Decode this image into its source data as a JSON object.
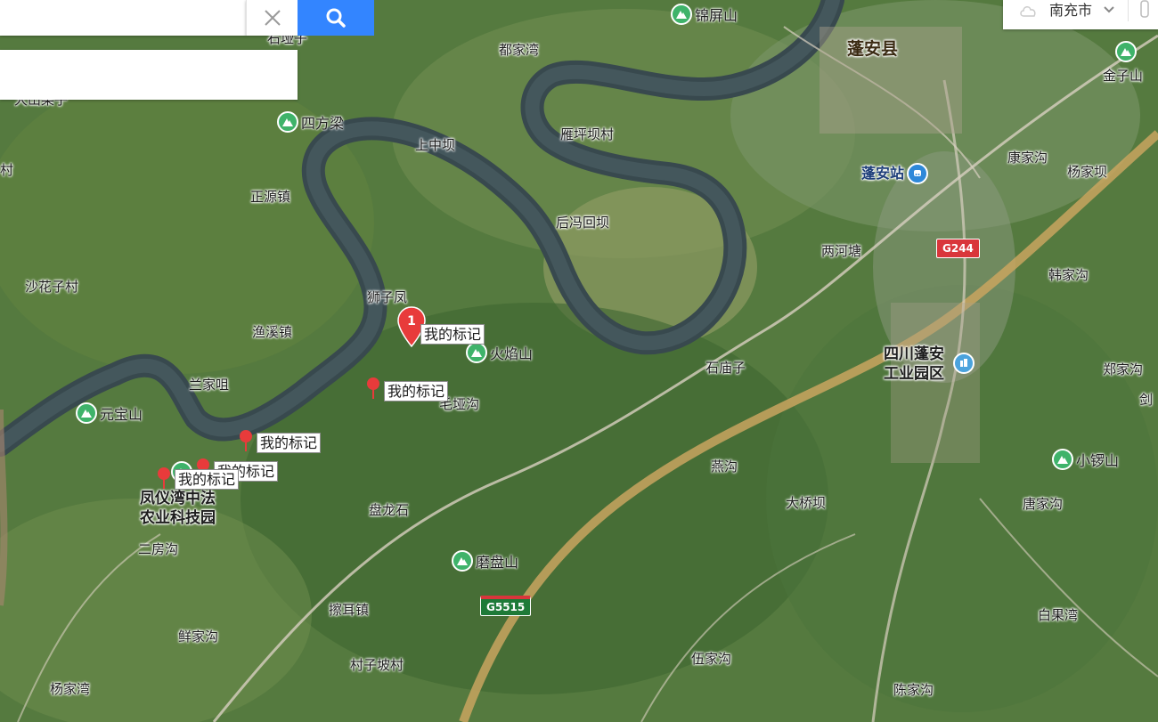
{
  "search": {
    "value": "",
    "placeholder": ""
  },
  "city_selector": {
    "label": "南充市"
  },
  "map": {
    "place_labels": [
      {
        "text": "都家湾"
      },
      {
        "text": "上中坝"
      },
      {
        "text": "雁坪坝村"
      },
      {
        "text": "正源镇"
      },
      {
        "text": "后冯回坝"
      },
      {
        "text": "两河塘"
      },
      {
        "text": "康家沟"
      },
      {
        "text": "杨家坝"
      },
      {
        "text": "沙花子村"
      },
      {
        "text": "渔溪镇"
      },
      {
        "text": "狮子凤"
      },
      {
        "text": "石庙子"
      },
      {
        "text": "韩家沟"
      },
      {
        "text": "兰家咀"
      },
      {
        "text": "毛垭沟"
      },
      {
        "text": "郑家沟"
      },
      {
        "text": "燕沟"
      },
      {
        "text": "大桥坝"
      },
      {
        "text": "唐家沟"
      },
      {
        "text": "二房沟"
      },
      {
        "text": "盘龙石"
      },
      {
        "text": "擦耳镇"
      },
      {
        "text": "白果湾"
      },
      {
        "text": "鲜家沟"
      },
      {
        "text": "村子坡村"
      },
      {
        "text": "伍家沟"
      },
      {
        "text": "杨家湾"
      },
      {
        "text": "陈家沟"
      },
      {
        "text": "石垭子"
      },
      {
        "text": "大山梁子"
      },
      {
        "text": "村"
      },
      {
        "text": "剑"
      }
    ],
    "county_label": "蓬安县",
    "poi_mountains": [
      {
        "text": "锦屏山"
      },
      {
        "text": "金子山"
      },
      {
        "text": "四方梁"
      },
      {
        "text": "火焰山"
      },
      {
        "text": "元宝山"
      },
      {
        "text": "小锣山"
      },
      {
        "text": "磨盘山"
      }
    ],
    "station_label": "蓬安站",
    "industrial_park": "四川蓬安工业园区",
    "industrial_park_lines": [
      "四川蓬安",
      "工业园区"
    ],
    "farm_park_lines": [
      "凤仪湾中法",
      "农业科技园"
    ],
    "road_shields": [
      {
        "text": "G244"
      },
      {
        "text": "G5515"
      }
    ],
    "markers": [
      {
        "label": "我的标记",
        "badge": "1"
      },
      {
        "label": "我的标记"
      },
      {
        "label": "我的标记"
      },
      {
        "label": "我的标记"
      },
      {
        "label": "我的标记"
      }
    ]
  },
  "colors": {
    "marker": "#e83b3b",
    "poi_green": "#3fb36a",
    "search_blue": "#3385ff",
    "shield_red": "#d9363b"
  }
}
